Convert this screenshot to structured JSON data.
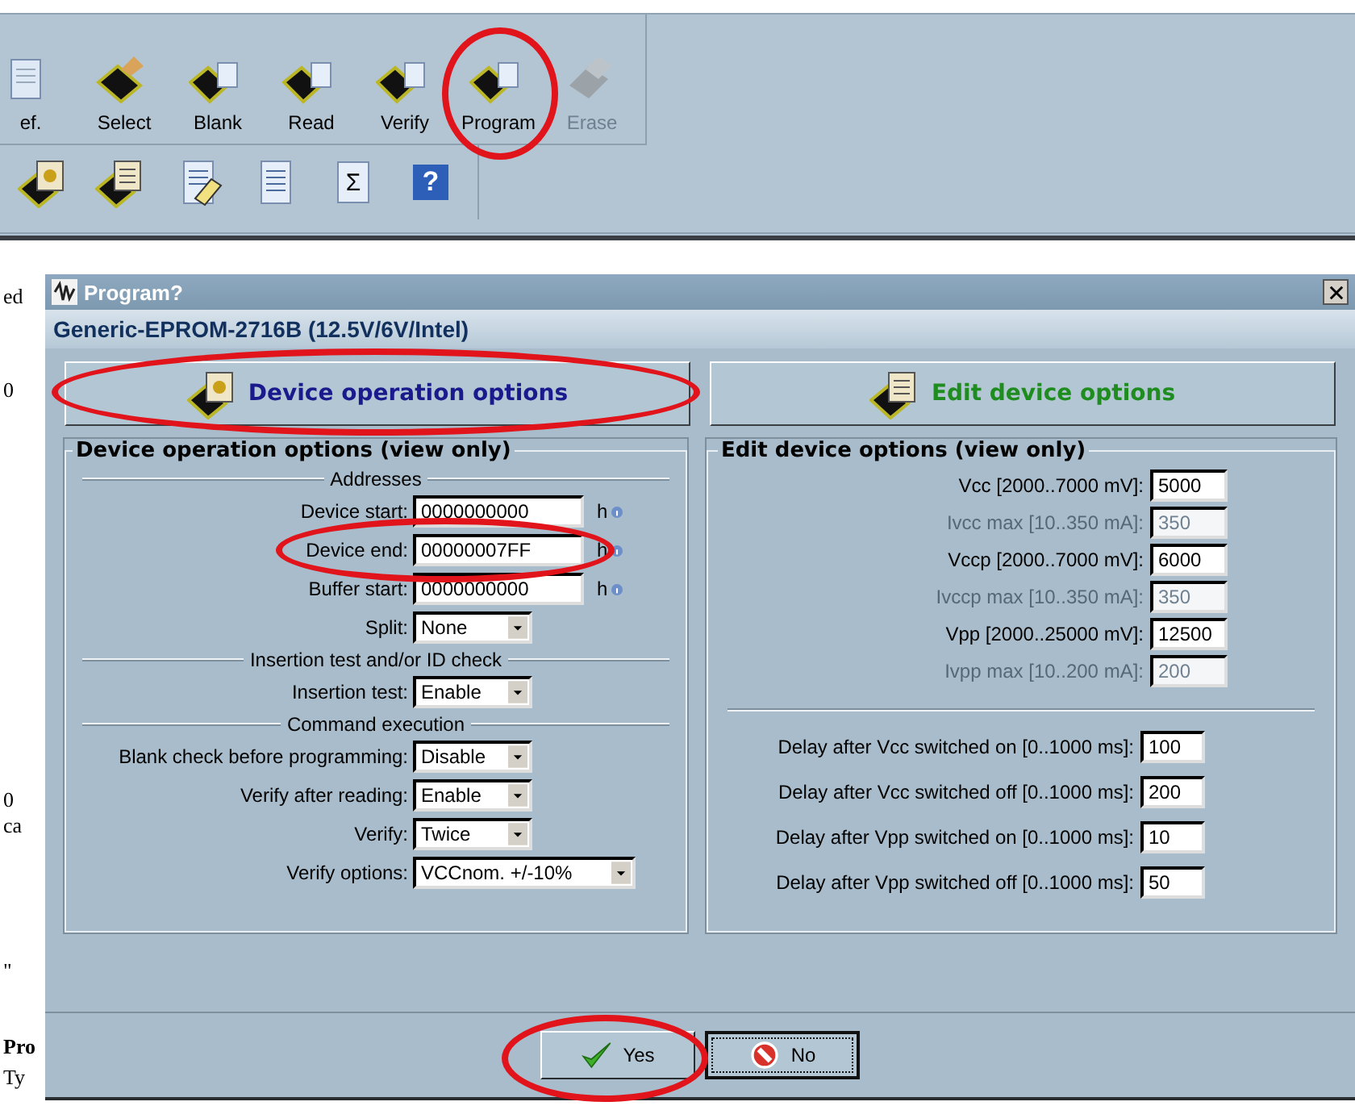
{
  "left_edge": [
    "ed",
    "0",
    "0",
    "ca",
    "\"",
    "Pro",
    "Ty"
  ],
  "toolbar": {
    "row1": [
      {
        "label": "ef.",
        "disabled": false,
        "circled": false
      },
      {
        "label": "Select",
        "disabled": false,
        "circled": false
      },
      {
        "label": "Blank",
        "disabled": false,
        "circled": false
      },
      {
        "label": "Read",
        "disabled": false,
        "circled": false
      },
      {
        "label": "Verify",
        "disabled": false,
        "circled": false
      },
      {
        "label": "Program",
        "disabled": false,
        "circled": true
      },
      {
        "label": "Erase",
        "disabled": true,
        "circled": false
      }
    ],
    "row2_glyphs": [
      "Σ",
      "?"
    ]
  },
  "dialog": {
    "title": "Program?",
    "device": "Generic-EPROM-2716B (12.5V/6V/Intel)",
    "tabs": [
      {
        "label": "Device operation options",
        "color": "#1a1a8c",
        "circled": true
      },
      {
        "label": "Edit device options",
        "color": "#1e8c1e",
        "circled": false
      }
    ],
    "left_group": {
      "title": "Device operation options (view only)",
      "sections": [
        {
          "heading": "Addresses",
          "rows": [
            {
              "kind": "hex",
              "label": "Device start:",
              "value": "0000000000",
              "unit": "h"
            },
            {
              "kind": "hex",
              "label": "Device end:",
              "value": "00000007FF",
              "unit": "h",
              "circled": true
            },
            {
              "kind": "hex",
              "label": "Buffer start:",
              "value": "0000000000",
              "unit": "h"
            },
            {
              "kind": "select",
              "label": "Split:",
              "value": "None"
            }
          ]
        },
        {
          "heading": "Insertion test and/or ID check",
          "rows": [
            {
              "kind": "select",
              "label": "Insertion test:",
              "value": "Enable"
            }
          ]
        },
        {
          "heading": "Command execution",
          "rows": [
            {
              "kind": "select",
              "label": "Blank check before programming:",
              "value": "Disable"
            },
            {
              "kind": "select",
              "label": "Verify after reading:",
              "value": "Enable"
            },
            {
              "kind": "select",
              "label": "Verify:",
              "value": "Twice"
            },
            {
              "kind": "wide-select",
              "label": "Verify options:",
              "value": "VCCnom. +/-10%"
            }
          ]
        }
      ]
    },
    "right_group": {
      "title": "Edit device options (view only)",
      "voltages": [
        {
          "label": "Vcc [2000..7000 mV]:",
          "value": "5000",
          "disabled": false
        },
        {
          "label": "Ivcc max [10..350 mA]:",
          "value": "350",
          "disabled": true
        },
        {
          "label": "Vccp [2000..7000 mV]:",
          "value": "6000",
          "disabled": false
        },
        {
          "label": "Ivccp max [10..350 mA]:",
          "value": "350",
          "disabled": true
        },
        {
          "label": "Vpp [2000..25000 mV]:",
          "value": "12500",
          "disabled": false
        },
        {
          "label": "Ivpp max [10..200 mA]:",
          "value": "200",
          "disabled": true
        }
      ],
      "delays": [
        {
          "label": "Delay after Vcc switched on [0..1000 ms]:",
          "value": "100"
        },
        {
          "label": "Delay after Vcc switched off [0..1000 ms]:",
          "value": "200"
        },
        {
          "label": "Delay after Vpp switched on [0..1000 ms]:",
          "value": "10"
        },
        {
          "label": "Delay after Vpp switched off [0..1000 ms]:",
          "value": "50"
        }
      ]
    },
    "buttons": [
      {
        "label": "Yes",
        "focused": false,
        "circled": true
      },
      {
        "label": "No",
        "focused": true,
        "circled": false
      }
    ]
  }
}
